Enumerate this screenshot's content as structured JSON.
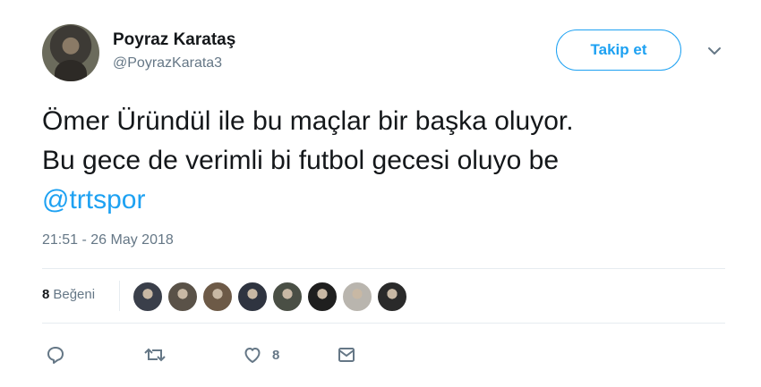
{
  "author": {
    "name": "Poyraz Karataş",
    "handle": "@PoyrazKarata3"
  },
  "follow_button": {
    "label": "Takip et"
  },
  "tweet": {
    "line1": "Ömer Üründül ile bu maçlar bir başka oluyor.",
    "line2": "Bu gece de verimli bi futbol gecesi oluyo be",
    "mention": "@trtspor",
    "timestamp": "21:51 - 26 May 2018"
  },
  "stats": {
    "likes_count": "8",
    "likes_label": "Beğeni"
  },
  "likers": [
    {
      "color": "#3a3f4a"
    },
    {
      "color": "#5a5248"
    },
    {
      "color": "#6d5a47"
    },
    {
      "color": "#2f3440"
    },
    {
      "color": "#4a4f45"
    },
    {
      "color": "#1f1f1f"
    },
    {
      "color": "#b9b5ae"
    },
    {
      "color": "#2a2a2a"
    }
  ],
  "actions": {
    "reply_icon": "reply-icon",
    "retweet_icon": "retweet-icon",
    "like_icon": "heart-icon",
    "like_count": "8",
    "message_icon": "envelope-icon"
  },
  "colors": {
    "accent": "#1da1f2",
    "text": "#14171a",
    "secondary": "#657786"
  }
}
